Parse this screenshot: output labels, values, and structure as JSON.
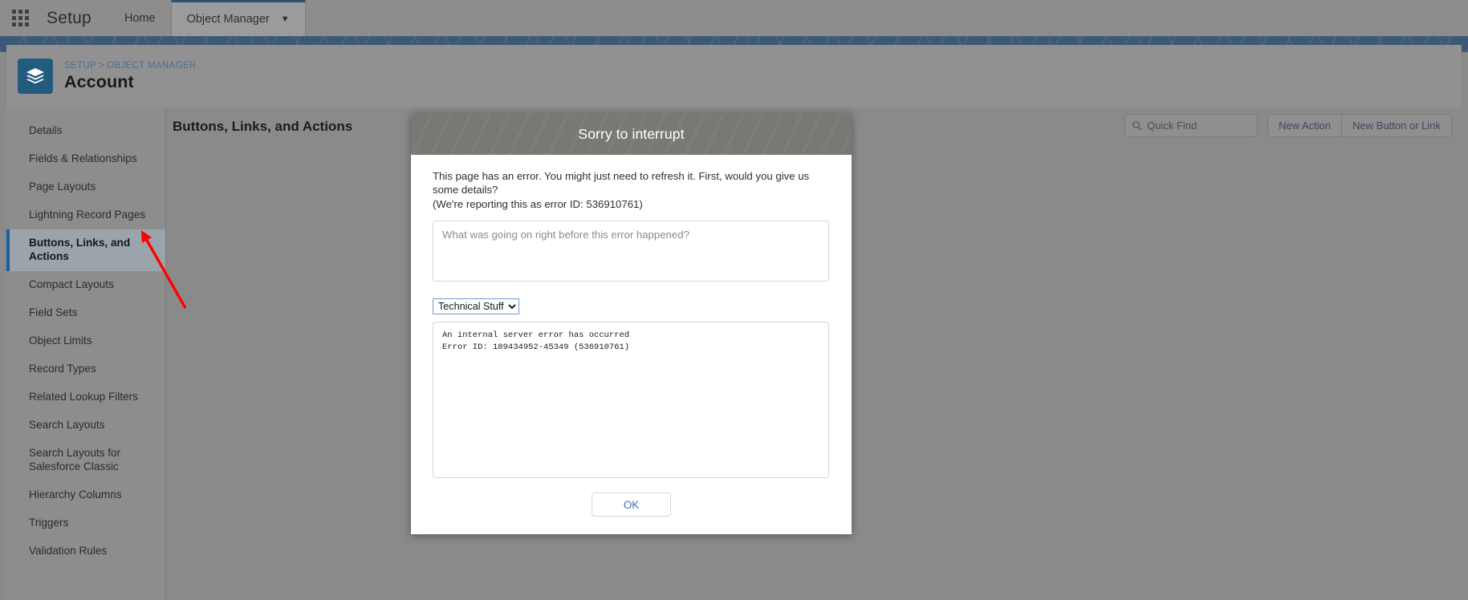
{
  "global_header": {
    "app_launcher_icon": "waffle-grid-icon",
    "setup_label": "Setup",
    "tabs": [
      {
        "label": "Home",
        "active": false,
        "has_chevron": false
      },
      {
        "label": "Object Manager",
        "active": true,
        "has_chevron": true
      }
    ]
  },
  "record_header": {
    "object_icon": "layers-icon",
    "breadcrumb": {
      "setup": "SETUP",
      "separator": ">",
      "object_manager": "OBJECT MANAGER"
    },
    "title": "Account"
  },
  "sidebar": {
    "items": [
      {
        "label": "Details",
        "active": false
      },
      {
        "label": "Fields & Relationships",
        "active": false
      },
      {
        "label": "Page Layouts",
        "active": false
      },
      {
        "label": "Lightning Record Pages",
        "active": false
      },
      {
        "label": "Buttons, Links, and Actions",
        "active": true
      },
      {
        "label": "Compact Layouts",
        "active": false
      },
      {
        "label": "Field Sets",
        "active": false
      },
      {
        "label": "Object Limits",
        "active": false
      },
      {
        "label": "Record Types",
        "active": false
      },
      {
        "label": "Related Lookup Filters",
        "active": false
      },
      {
        "label": "Search Layouts",
        "active": false
      },
      {
        "label": "Search Layouts for Salesforce Classic",
        "active": false
      },
      {
        "label": "Hierarchy Columns",
        "active": false
      },
      {
        "label": "Triggers",
        "active": false
      },
      {
        "label": "Validation Rules",
        "active": false
      }
    ]
  },
  "main": {
    "title": "Buttons, Links, and Actions",
    "search": {
      "icon": "search-icon",
      "placeholder": "Quick Find",
      "value": ""
    },
    "buttons": [
      {
        "label": "New Action"
      },
      {
        "label": "New Button or Link"
      }
    ]
  },
  "modal": {
    "title": "Sorry to interrupt",
    "message_line1": "This page has an error. You might just need to refresh it. First, would you give us some details?",
    "message_line2": "(We're reporting this as error ID: 536910761)",
    "error_id": "536910761",
    "details_textarea": {
      "placeholder": "What was going on right before this error happened?",
      "value": ""
    },
    "select": {
      "selected": "Technical Stuff",
      "options": [
        "Technical Stuff"
      ],
      "icon": "chevron-down-icon"
    },
    "technical_details": "An internal server error has occurred\nError ID: 189434952-45349 (536910761)",
    "ok_button": "OK"
  },
  "annotation": {
    "arrow_color": "#ff0000",
    "target": "Buttons, Links, and Actions"
  },
  "colors": {
    "brand_blue": "#2d5472",
    "object_icon_bg": "#235b7f",
    "active_nav_border": "#1b5f9e",
    "link_blue": "#4a6f96",
    "button_text": "#3c4a5c",
    "ok_text": "#3a6fb5",
    "modal_header_bg": "#7a7872",
    "annotation_red": "#ff0000"
  }
}
